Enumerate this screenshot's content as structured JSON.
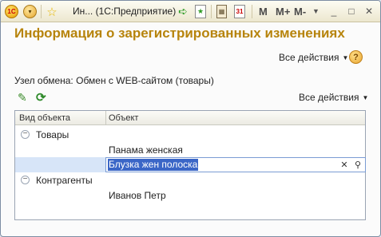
{
  "titlebar": {
    "logo_text": "1С",
    "title": "Ин... (1С:Предприятие)",
    "mem_m": "M",
    "mem_mplus": "M+",
    "mem_mminus": "M-"
  },
  "form": {
    "heading": "Информация о зарегистрированных изменениях",
    "all_actions_top": "Все действия",
    "help": "?",
    "node_label": "Узел обмена: Обмен с WEB-сайтом (товары)",
    "all_actions_table": "Все действия"
  },
  "table": {
    "columns": [
      "Вид объекта",
      "Объект"
    ],
    "rows": [
      {
        "type": "group",
        "label": "Товары"
      },
      {
        "type": "item",
        "object": "Панама женская"
      },
      {
        "type": "editing",
        "object": "Блузка жен полоска"
      },
      {
        "type": "group",
        "label": "Контрагенты"
      },
      {
        "type": "item",
        "object": "Иванов Петр"
      }
    ]
  },
  "colors": {
    "heading": "#b7840c",
    "selection": "#3a66c7",
    "row_highlight": "#d7e5f8"
  }
}
